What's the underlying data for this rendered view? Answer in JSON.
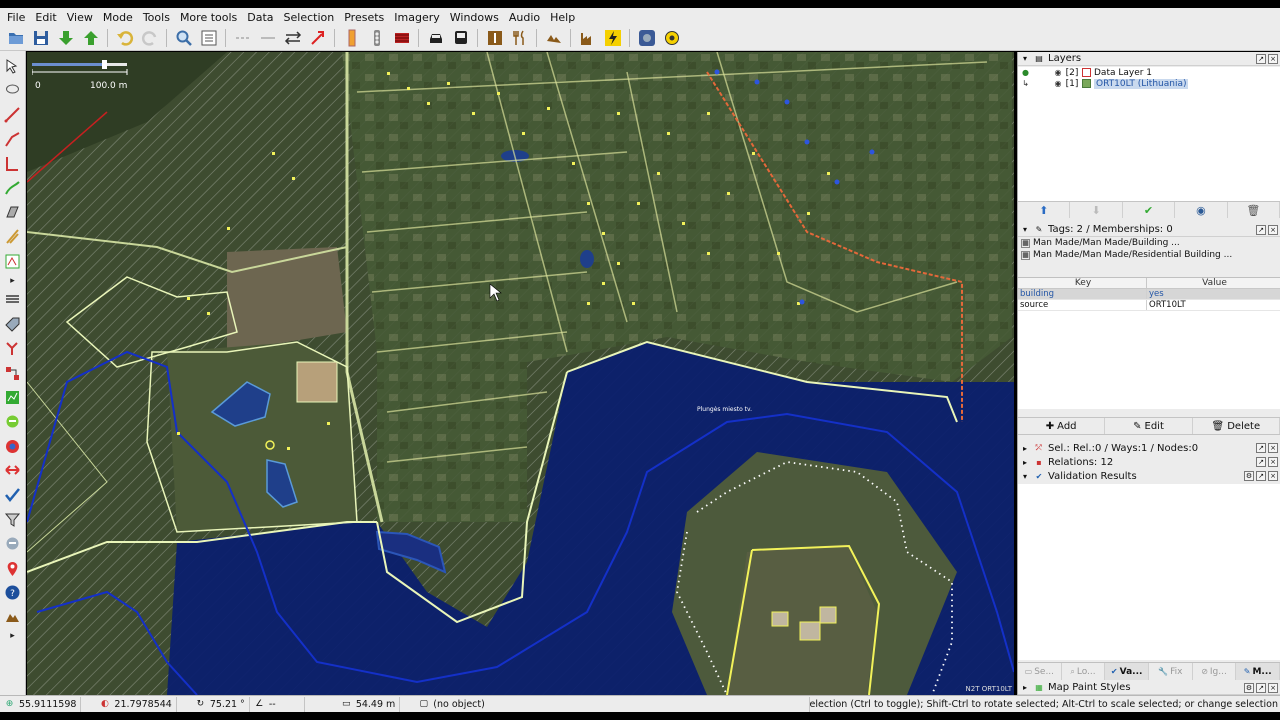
{
  "menu": [
    "File",
    "Edit",
    "View",
    "Mode",
    "Tools",
    "More tools",
    "Data",
    "Selection",
    "Presets",
    "Imagery",
    "Windows",
    "Audio",
    "Help"
  ],
  "toolbar_icons": [
    "open-file-icon",
    "save-icon",
    "download-icon",
    "upload-icon",
    "undo-icon",
    "redo-icon",
    "zoom-icon",
    "preferences-icon",
    "split-way-icon",
    "combine-way-icon",
    "reverse-way-icon",
    "shuffle-icon",
    "barrier-icon",
    "traffic-signal-icon",
    "building-icon",
    "car-icon",
    "bus-icon",
    "amenity-icon",
    "food-icon",
    "landuse-icon",
    "industrial-icon",
    "power-icon",
    "target-icon",
    "sun-icon"
  ],
  "map": {
    "scale_start": "0",
    "scale_length": "100.0 m",
    "water_label": "Plungės miesto tv.",
    "attribution": "N2T ORT10LT"
  },
  "layers": {
    "title": "Layers",
    "items": [
      {
        "index": "[2]",
        "name": "Data Layer 1",
        "active": true,
        "selected": false
      },
      {
        "index": "[1]",
        "name": "ORT10LT (Lithuania)",
        "active": false,
        "selected": true
      }
    ]
  },
  "tags": {
    "title": "Tags: 2 / Memberships: 0",
    "presets": [
      "Man Made/Man Made/Building ...",
      "Man Made/Man Made/Residential Building ..."
    ],
    "col_key": "Key",
    "col_value": "Value",
    "rows": [
      {
        "key": "building",
        "value": "yes"
      },
      {
        "key": "source",
        "value": "ORT10LT"
      }
    ],
    "add": "Add",
    "edit": "Edit",
    "delete": "Delete"
  },
  "panels": {
    "selection": "Sel.: Rel.:0 / Ways:1 / Nodes:0",
    "relations": "Relations: 12",
    "validation": "Validation Results",
    "map_paint": "Map Paint Styles"
  },
  "bottom_tabs": [
    "Se...",
    "Lo...",
    "Va...",
    "Fix",
    "Ig...",
    "M..."
  ],
  "status": {
    "lat": "55.9111598",
    "lon": "21.7978544",
    "heading": "75.21 °",
    "angle": "--",
    "distance": "54.49 m",
    "object": "(no object)",
    "help": "t to add to selection (Ctrl to toggle); Shift-Ctrl to rotate selected; Alt-Ctrl to scale selected; or change selection"
  },
  "colors": {
    "selection_blue": "#c9d9ee",
    "water_blue": "#0b1f6e",
    "way_yellow": "#f2f25a",
    "landuse_outline": "#e9f5b9"
  }
}
